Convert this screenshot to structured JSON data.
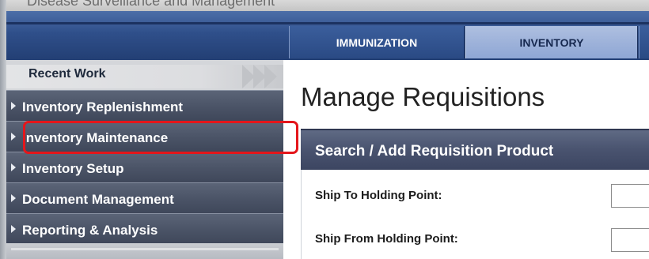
{
  "banner": {
    "text": "Disease Surveillance and Management"
  },
  "nav": {
    "tabs": [
      {
        "label": "IMMUNIZATION",
        "active": false
      },
      {
        "label": "INVENTORY",
        "active": true
      }
    ]
  },
  "sidebar": {
    "recent_work_label": "Recent Work",
    "items": [
      {
        "label": "Inventory Replenishment"
      },
      {
        "label": "Inventory Maintenance",
        "highlighted": true
      },
      {
        "label": "Inventory Setup"
      },
      {
        "label": "Document Management"
      },
      {
        "label": "Reporting & Analysis"
      }
    ]
  },
  "main": {
    "page_title": "Manage Requisitions",
    "panel": {
      "title": "Search / Add Requisition Product",
      "fields": [
        {
          "label": "Ship To Holding Point:",
          "value": ""
        },
        {
          "label": "Ship From Holding Point:",
          "value": ""
        }
      ]
    }
  },
  "colors": {
    "highlight": "#e4161b",
    "nav_active_tab": "#8ea6d4",
    "sidebar_item": "#4a5366",
    "panel_header": "#4a5470"
  },
  "icons": {
    "sidebar_item_arrow": "caret-right-icon",
    "recent_work_decoration": "chevron-right-icon"
  }
}
